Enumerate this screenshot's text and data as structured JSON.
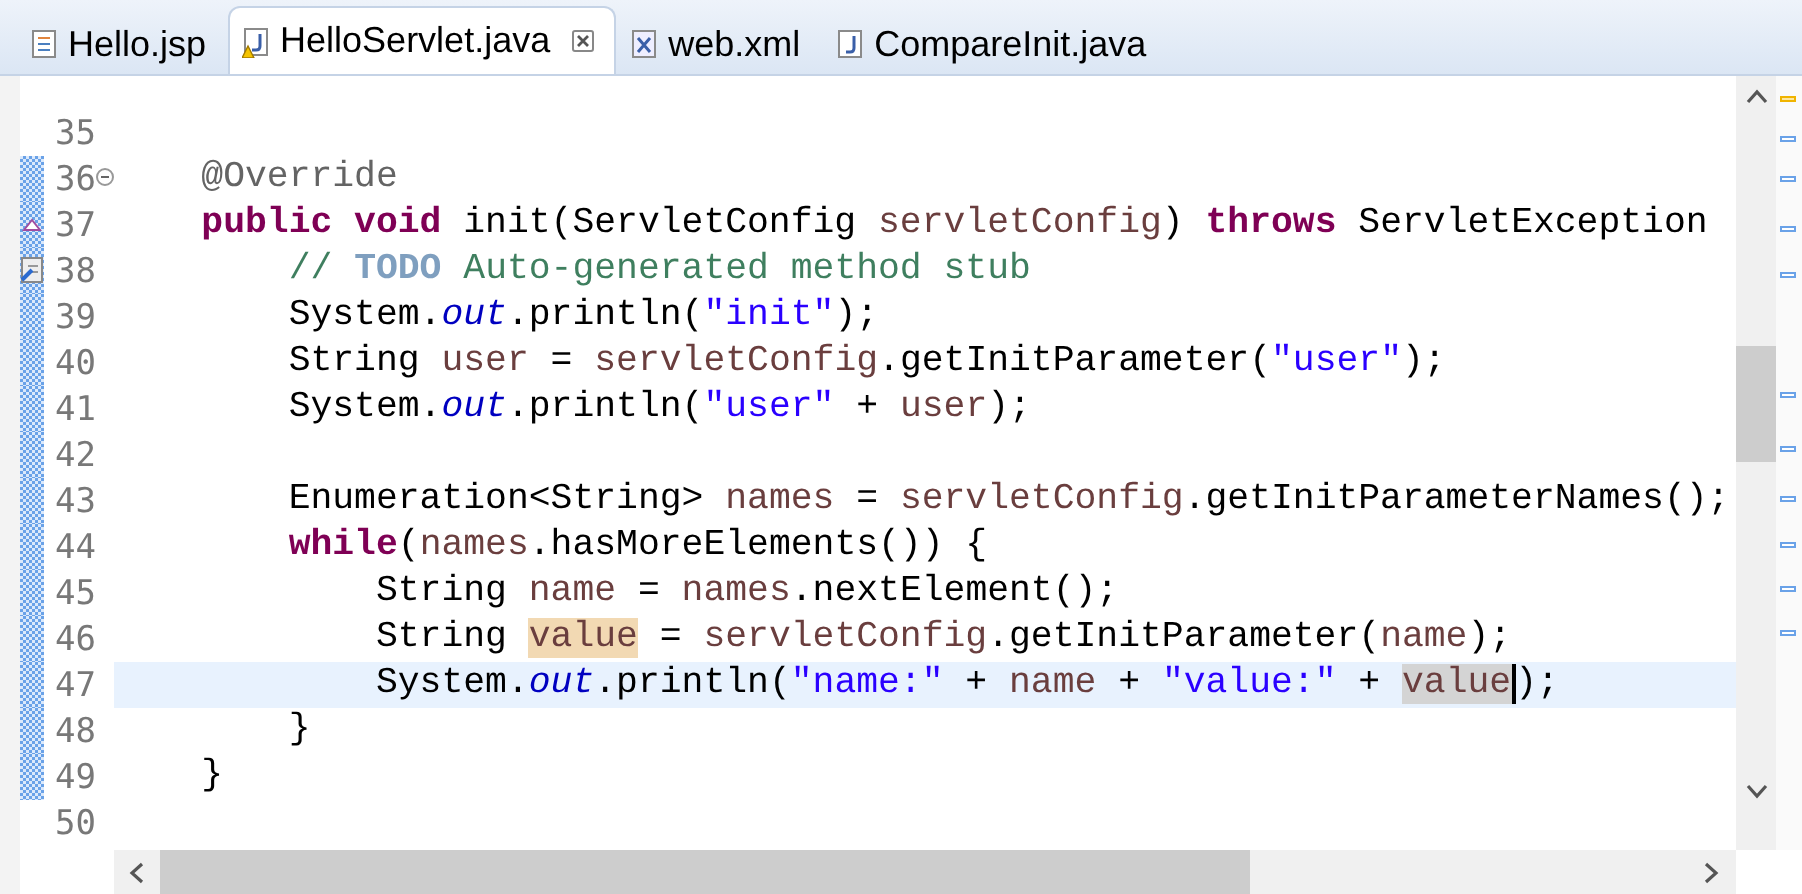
{
  "tabs": [
    {
      "label": "Hello.jsp",
      "kind": "jsp",
      "selected": false,
      "warning": false
    },
    {
      "label": "HelloServlet.java",
      "kind": "java",
      "selected": true,
      "warning": true
    },
    {
      "label": "web.xml",
      "kind": "xml",
      "selected": false,
      "warning": false
    },
    {
      "label": "CompareInit.java",
      "kind": "java",
      "selected": false,
      "warning": false
    }
  ],
  "lines": [
    {
      "number": "35",
      "changed": false,
      "current": false
    },
    {
      "number": "36",
      "changed": true,
      "current": false,
      "gutter_icon": {
        "kind": "fold"
      },
      "tokens": [
        {
          "text": "    @Override",
          "kind": "annotation"
        }
      ]
    },
    {
      "number": "37",
      "changed": true,
      "current": false,
      "gutter_icon": {
        "kind": "override"
      },
      "tokens": [
        {
          "text": "    public void",
          "kind": "keyword"
        },
        {
          "text": " init(ServletConfig ",
          "kind": "plain"
        },
        {
          "text": "servletConfig",
          "kind": "param"
        },
        {
          "text": ") ",
          "kind": "plain"
        },
        {
          "text": "throws",
          "kind": "keyword"
        },
        {
          "text": " ServletException",
          "kind": "plain"
        }
      ]
    },
    {
      "number": "38",
      "changed": true,
      "current": false,
      "gutter_icon": {
        "kind": "task"
      },
      "tokens": [
        {
          "text": "        // ",
          "kind": "comment"
        },
        {
          "text": "TODO",
          "kind": "todo"
        },
        {
          "text": " Auto-generated method stub",
          "kind": "comment"
        }
      ]
    },
    {
      "number": "39",
      "changed": true,
      "current": false,
      "tokens": [
        {
          "text": "        System.",
          "kind": "plain"
        },
        {
          "text": "out",
          "kind": "field"
        },
        {
          "text": ".println(",
          "kind": "plain"
        },
        {
          "text": "\"init\"",
          "kind": "string"
        },
        {
          "text": ");",
          "kind": "plain"
        }
      ]
    },
    {
      "number": "40",
      "changed": true,
      "current": false,
      "tokens": [
        {
          "text": "        String ",
          "kind": "plain"
        },
        {
          "text": "user",
          "kind": "variable"
        },
        {
          "text": " = ",
          "kind": "plain"
        },
        {
          "text": "servletConfig",
          "kind": "param"
        },
        {
          "text": ".getInitParameter(",
          "kind": "plain"
        },
        {
          "text": "\"user\"",
          "kind": "string"
        },
        {
          "text": ");",
          "kind": "plain"
        }
      ]
    },
    {
      "number": "41",
      "changed": true,
      "current": false,
      "tokens": [
        {
          "text": "        System.",
          "kind": "plain"
        },
        {
          "text": "out",
          "kind": "field"
        },
        {
          "text": ".println(",
          "kind": "plain"
        },
        {
          "text": "\"user\"",
          "kind": "string"
        },
        {
          "text": " + ",
          "kind": "plain"
        },
        {
          "text": "user",
          "kind": "variable"
        },
        {
          "text": ");",
          "kind": "plain"
        }
      ]
    },
    {
      "number": "42",
      "changed": true,
      "current": false
    },
    {
      "number": "43",
      "changed": true,
      "current": false,
      "tokens": [
        {
          "text": "        Enumeration<String> ",
          "kind": "plain"
        },
        {
          "text": "names",
          "kind": "variable"
        },
        {
          "text": " = ",
          "kind": "plain"
        },
        {
          "text": "servletConfig",
          "kind": "param"
        },
        {
          "text": ".getInitParameterNames();",
          "kind": "plain"
        }
      ]
    },
    {
      "number": "44",
      "changed": true,
      "current": false,
      "tokens": [
        {
          "text": "        while",
          "kind": "keyword"
        },
        {
          "text": "(",
          "kind": "plain"
        },
        {
          "text": "names",
          "kind": "variable"
        },
        {
          "text": ".hasMoreElements()) {",
          "kind": "plain"
        }
      ]
    },
    {
      "number": "45",
      "changed": true,
      "current": false,
      "tokens": [
        {
          "text": "            String ",
          "kind": "plain"
        },
        {
          "text": "name",
          "kind": "variable"
        },
        {
          "text": " = ",
          "kind": "plain"
        },
        {
          "text": "names",
          "kind": "variable"
        },
        {
          "text": ".nextElement();",
          "kind": "plain"
        }
      ]
    },
    {
      "number": "46",
      "changed": true,
      "current": false,
      "tokens": [
        {
          "text": "            String ",
          "kind": "plain"
        },
        {
          "text": "value",
          "kind": "write-occurrence"
        },
        {
          "text": " = ",
          "kind": "plain"
        },
        {
          "text": "servletConfig",
          "kind": "param"
        },
        {
          "text": ".getInitParameter(",
          "kind": "plain"
        },
        {
          "text": "name",
          "kind": "variable"
        },
        {
          "text": ");",
          "kind": "plain"
        }
      ]
    },
    {
      "number": "47",
      "changed": true,
      "current": true,
      "tokens": [
        {
          "text": "            System.",
          "kind": "plain"
        },
        {
          "text": "out",
          "kind": "field"
        },
        {
          "text": ".println(",
          "kind": "plain"
        },
        {
          "text": "\"name:\"",
          "kind": "string"
        },
        {
          "text": " + ",
          "kind": "plain"
        },
        {
          "text": "name",
          "kind": "variable"
        },
        {
          "text": " + ",
          "kind": "plain"
        },
        {
          "text": "\"value:\"",
          "kind": "string"
        },
        {
          "text": " + ",
          "kind": "plain"
        },
        {
          "text": "value",
          "kind": "read-occurrence",
          "cursor": true
        },
        {
          "text": ");",
          "kind": "plain"
        }
      ]
    },
    {
      "number": "48",
      "changed": true,
      "current": false,
      "tokens": [
        {
          "text": "        }",
          "kind": "plain"
        }
      ]
    },
    {
      "number": "49",
      "changed": true,
      "current": false,
      "tokens": [
        {
          "text": "    }",
          "kind": "plain"
        }
      ]
    },
    {
      "number": "50",
      "changed": false,
      "current": false
    }
  ]
}
